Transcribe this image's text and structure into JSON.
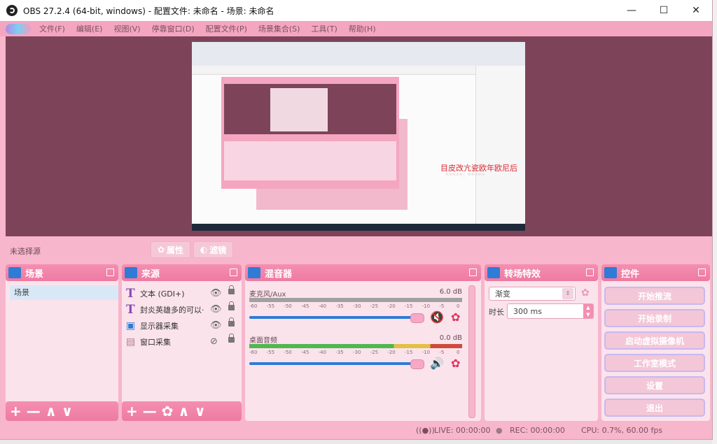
{
  "window": {
    "title": "OBS 27.2.4 (64-bit, windows) - 配置文件: 未命名 - 场景: 未命名",
    "minimize": "—",
    "maximize": "☐",
    "close": "✕"
  },
  "menu": [
    "文件(F)",
    "编辑(E)",
    "视图(V)",
    "停靠窗口(D)",
    "配置文件(P)",
    "场景集合(S)",
    "工具(T)",
    "帮助(H)"
  ],
  "preview": {
    "overlay_line1": "目皮改亢瓷欧年欧尼后",
    "overlay_line2": "*****: *****"
  },
  "source_toolbar": {
    "no_source_label": "未选择源",
    "properties_label": "属性",
    "filters_label": "滤镜"
  },
  "scenes": {
    "title": "场景",
    "items": [
      "场景"
    ],
    "footer": "+ — ∧ ∨"
  },
  "sources": {
    "title": "来源",
    "items": [
      {
        "icon": "T",
        "label": "文本 (GDI+)",
        "visibility": "👁"
      },
      {
        "icon": "T",
        "label": "封炎英雄多的可以·",
        "visibility": "👁"
      },
      {
        "icon": "▣",
        "label": "显示器采集",
        "visibility": "👁"
      },
      {
        "icon": "▤",
        "label": "窗口采集",
        "visibility": "⊘"
      }
    ],
    "footer": "+ — ✿ ∧ ∨"
  },
  "mixer": {
    "title": "混音器",
    "channels": [
      {
        "name": "麦克风/Aux",
        "db": "6.0 dB",
        "mute": "🔇",
        "gear": "✿"
      },
      {
        "name": "桌面音频",
        "db": "0.0 dB",
        "mute": "🔊",
        "gear": "✿"
      }
    ],
    "ticks": [
      "-60",
      "-55",
      "-50",
      "-45",
      "-40",
      "-35",
      "-30",
      "-25",
      "-20",
      "-15",
      "-10",
      "-5",
      "0"
    ]
  },
  "transitions": {
    "title": "转场特效",
    "selected": "渐变",
    "duration_label": "时长",
    "duration_value": "300 ms"
  },
  "controls": {
    "title": "控件",
    "buttons": [
      "开始推流",
      "开始录制",
      "启动虚拟摄像机",
      "工作室模式",
      "设置",
      "退出"
    ]
  },
  "status": {
    "live": "LIVE: 00:00:00",
    "rec": "REC: 00:00:00",
    "cpu": "CPU: 0.7%, 60.00 fps"
  },
  "colors": {
    "accent": "#f48fb1",
    "background": "#f7b6cc",
    "preview": "#7d4459",
    "icon_blue": "#2f7bd6"
  }
}
